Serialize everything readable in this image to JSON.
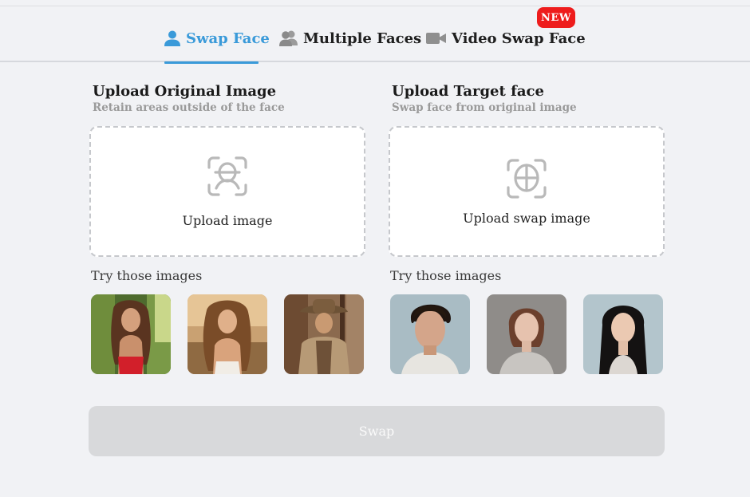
{
  "tabs": [
    {
      "label": "Swap Face",
      "icon": "person-icon",
      "active": true
    },
    {
      "label": "Multiple Faces",
      "icon": "group-icon",
      "active": false
    },
    {
      "label": "Video Swap Face",
      "icon": "video-camera-icon",
      "active": false,
      "badge": "NEW"
    }
  ],
  "original": {
    "title": "Upload Original Image",
    "subtitle": "Retain areas outside of the face",
    "upload_label": "Upload image",
    "try_label": "Try those images"
  },
  "target": {
    "title": "Upload Target face",
    "subtitle": "Swap face from original image",
    "upload_label": "Upload swap image",
    "try_label": "Try those images"
  },
  "swap_button": "Swap",
  "colors": {
    "accent": "#3a9ad9",
    "badge": "#ee1c1c",
    "background": "#f1f2f5",
    "disabled_button": "#d8d9db"
  }
}
